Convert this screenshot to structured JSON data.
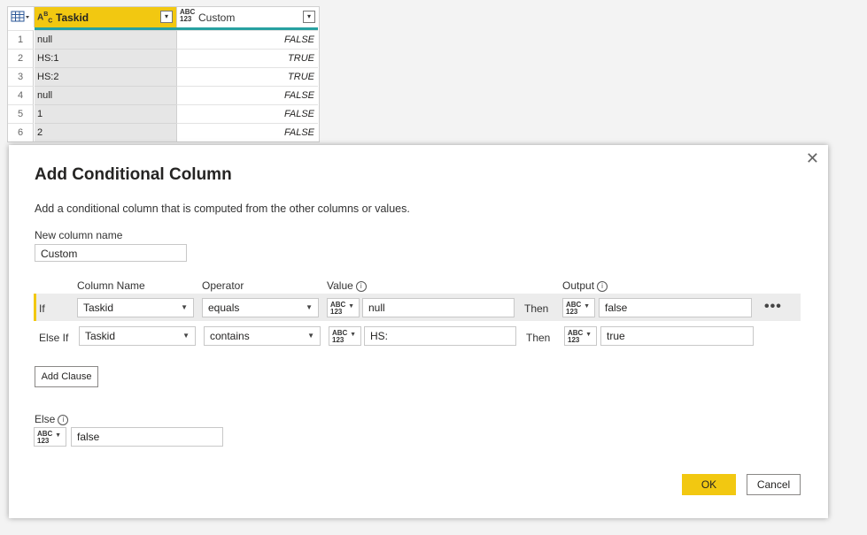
{
  "grid": {
    "columns": [
      {
        "type_icon": "ABC",
        "name": "Taskid"
      },
      {
        "type_icon": "ABC123",
        "name": "Custom"
      }
    ],
    "rows": [
      {
        "num": "1",
        "taskid": "null",
        "custom": "FALSE"
      },
      {
        "num": "2",
        "taskid": "HS:1",
        "custom": "TRUE"
      },
      {
        "num": "3",
        "taskid": "HS:2",
        "custom": "TRUE"
      },
      {
        "num": "4",
        "taskid": "null",
        "custom": "FALSE"
      },
      {
        "num": "5",
        "taskid": "1",
        "custom": "FALSE"
      },
      {
        "num": "6",
        "taskid": "2",
        "custom": "FALSE"
      }
    ]
  },
  "dialog": {
    "title": "Add Conditional Column",
    "description": "Add a conditional column that is computed from the other columns or values.",
    "new_column_label": "New column name",
    "new_column_value": "Custom",
    "headers": {
      "column_name": "Column Name",
      "operator": "Operator",
      "value": "Value",
      "output": "Output"
    },
    "clauses": [
      {
        "keyword": "If",
        "column": "Taskid",
        "operator": "equals",
        "value_type": "ABC 123",
        "value": "null",
        "then": "Then",
        "output_type": "ABC 123",
        "output": "false"
      },
      {
        "keyword": "Else If",
        "column": "Taskid",
        "operator": "contains",
        "value_type": "ABC 123",
        "value": "HS:",
        "then": "Then",
        "output_type": "ABC 123",
        "output": "true"
      }
    ],
    "more_label": "•••",
    "add_clause_label": "Add Clause",
    "else_label": "Else",
    "else_type": "ABC 123",
    "else_value": "false",
    "ok_label": "OK",
    "cancel_label": "Cancel",
    "close_label": "✕"
  },
  "colors": {
    "accent": "#f2c811",
    "teal": "#27a1a1"
  }
}
